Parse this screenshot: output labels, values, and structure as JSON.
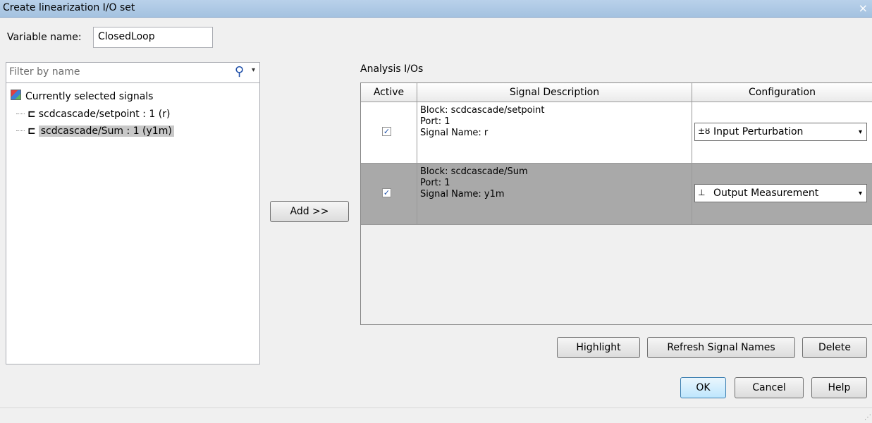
{
  "window": {
    "title": "Create linearization I/O set",
    "close": "×"
  },
  "variable": {
    "label": "Variable name:",
    "value": "ClosedLoop"
  },
  "filter": {
    "placeholder": "Filter by name",
    "search_icon": "⚲",
    "dropdown_icon": "▾"
  },
  "tree": {
    "root_label": "Currently selected signals",
    "items": [
      {
        "glyph": "⊏",
        "label": "scdcascade/setpoint : 1 (r)"
      },
      {
        "glyph": "⊏",
        "label": "scdcascade/Sum : 1 (y1m)"
      }
    ]
  },
  "add_button": "Add >>",
  "analysis": {
    "title": "Analysis I/Os",
    "headers": {
      "active": "Active",
      "description": "Signal Description",
      "configuration": "Configuration"
    },
    "rows": [
      {
        "checked": "✓",
        "block": "Block: scdcascade/setpoint",
        "port": "Port: 1",
        "signal": "Signal Name: r",
        "config_icon": "±ȣ",
        "config": "Input Perturbation"
      },
      {
        "checked": "✓",
        "block": "Block: scdcascade/Sum",
        "port": "Port: 1",
        "signal": "Signal Name: y1m",
        "config_icon": "⊥",
        "config": "Output Measurement"
      }
    ]
  },
  "buttons": {
    "highlight": "Highlight",
    "refresh": "Refresh Signal Names",
    "delete": "Delete",
    "ok": "OK",
    "cancel": "Cancel",
    "help": "Help"
  },
  "combo_arrow": "▾",
  "resize_grip": "⋰"
}
